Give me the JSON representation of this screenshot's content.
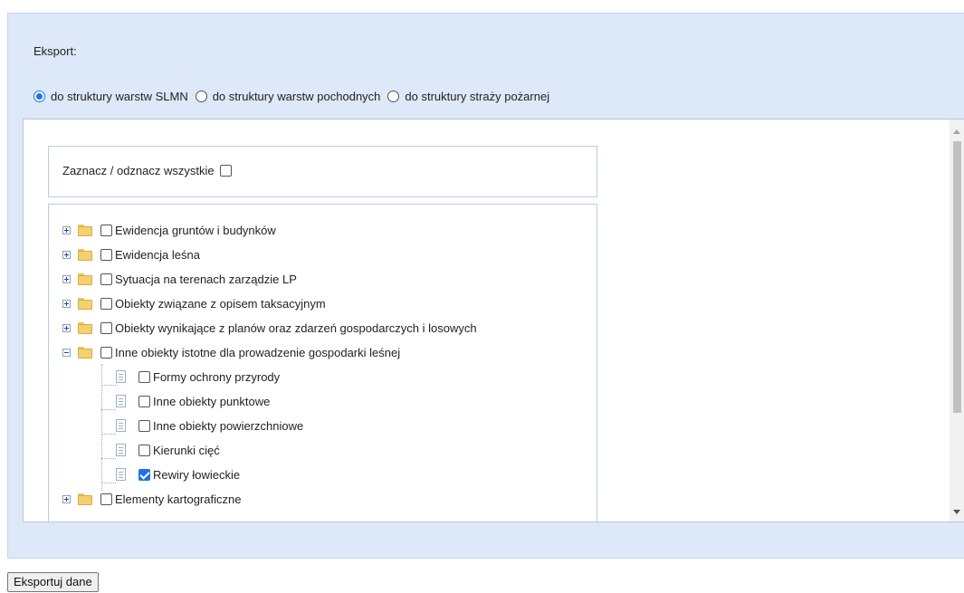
{
  "export": {
    "label": "Eksport:",
    "options": [
      {
        "label": "do struktury warstw SLMN",
        "selected": true
      },
      {
        "label": "do struktury warstw pochodnych",
        "selected": false
      },
      {
        "label": "do struktury straży pożarnej",
        "selected": false
      }
    ]
  },
  "select_all": {
    "label": "Zaznacz / odznacz wszystkie",
    "checked": false
  },
  "tree": [
    {
      "label": "Ewidencja gruntów i budynków",
      "type": "folder",
      "expanded": false,
      "checked": false
    },
    {
      "label": "Ewidencja leśna",
      "type": "folder",
      "expanded": false,
      "checked": false
    },
    {
      "label": "Sytuacja na terenach zarządzie LP",
      "type": "folder",
      "expanded": false,
      "checked": false
    },
    {
      "label": "Obiekty związane z opisem taksacyjnym",
      "type": "folder",
      "expanded": false,
      "checked": false
    },
    {
      "label": "Obiekty wynikające z planów oraz zdarzeń gospodarczych i losowych",
      "type": "folder",
      "expanded": false,
      "checked": false
    },
    {
      "label": "Inne obiekty istotne dla prowadzenie gospodarki leśnej",
      "type": "folder",
      "expanded": true,
      "checked": false,
      "children": [
        {
          "label": "Formy ochrony przyrody",
          "checked": false
        },
        {
          "label": "Inne obiekty punktowe",
          "checked": false
        },
        {
          "label": "Inne obiekty powierzchniowe",
          "checked": false
        },
        {
          "label": "Kierunki cięć",
          "checked": false
        },
        {
          "label": "Rewiry łowieckie",
          "checked": true
        }
      ]
    },
    {
      "label": "Elementy kartograficzne",
      "type": "folder",
      "expanded": false,
      "checked": false
    }
  ],
  "export_button": "Eksportuj dane"
}
